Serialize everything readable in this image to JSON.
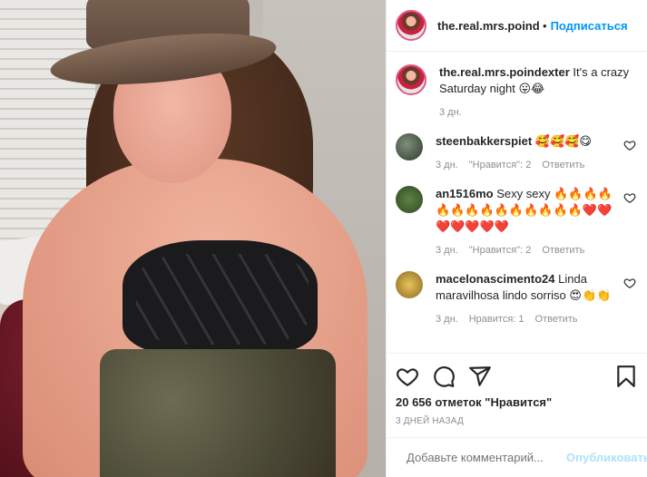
{
  "header": {
    "username": "the.real.mrs.poindexter",
    "dot": "•",
    "follow_label": "Подписаться"
  },
  "caption": {
    "username": "the.real.mrs.poindexter",
    "text": "It's a crazy Saturday night 😛😂",
    "time": "3 дн."
  },
  "comments": [
    {
      "username": "steenbakkerspiet",
      "text": "🥰🥰🥰😋",
      "time": "3 дн.",
      "likes": "\"Нравится\": 2",
      "reply": "Ответить",
      "avatar_color": "#3e4a3a"
    },
    {
      "username": "an1516mo",
      "text": "Sexy sexy 🔥🔥🔥🔥🔥🔥🔥🔥🔥🔥🔥🔥🔥🔥❤️❤️❤️❤️❤️❤️❤️",
      "time": "3 дн.",
      "likes": "\"Нравится\": 2",
      "reply": "Ответить",
      "avatar_color": "#4f6b3a"
    },
    {
      "username": "macelonascimento24",
      "text": "Linda maravilhosa lindo sorriso 😍👏👏",
      "time": "3 дн.",
      "likes": "Нравится: 1",
      "reply": "Ответить",
      "avatar_color": "#c7a23a"
    }
  ],
  "likes_text": "20 656 отметок \"Нравится\"",
  "date_text": "3 ДНЕЙ НАЗАД",
  "add_comment": {
    "placeholder": "Добавьте комментарий...",
    "post_label": "Опубликовать"
  },
  "icons": {
    "like": "heart-icon",
    "comment": "comment-icon",
    "share": "paper-plane-icon",
    "save": "bookmark-icon",
    "emoji": "smiley-icon"
  },
  "colors": {
    "accent": "#0095f6",
    "post_disabled": "#b2dffc",
    "muted": "#8e8e8e",
    "story_ring": "#e0588a"
  }
}
